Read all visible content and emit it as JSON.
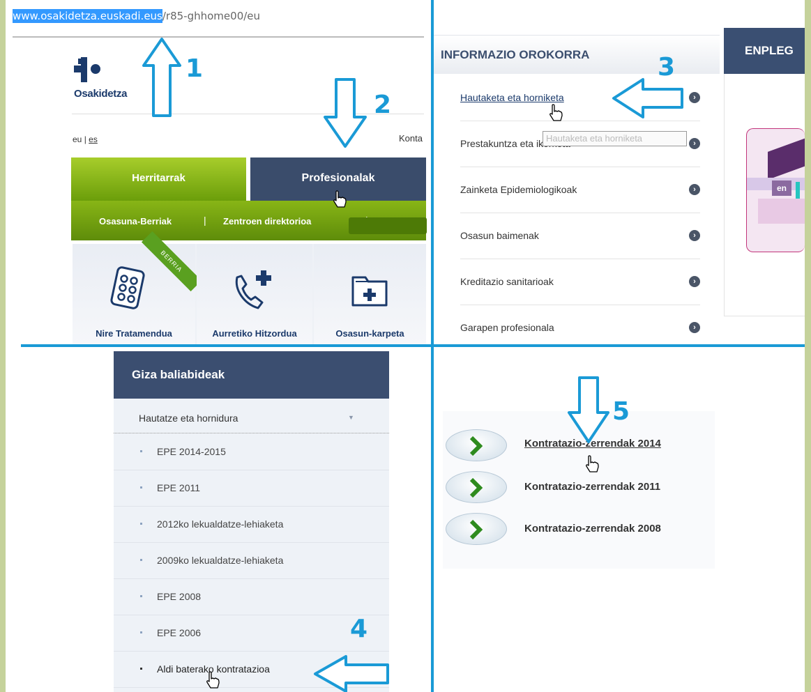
{
  "q1": {
    "url_highlight": "www.osakidetza.euskadi.eus",
    "url_rest": "/r85-ghhome00/eu",
    "logo_text": "Osakidetza",
    "lang_eu": "eu",
    "lang_sep": "|",
    "lang_es": "es",
    "konta_text": "Konta",
    "tab_herritarrak": "Herritarrak",
    "tab_profesionalak": "Profesionalak",
    "subnav": [
      "Osasuna-Berriak",
      "Zentroen direktorioa"
    ],
    "subnav_sep": "|",
    "ribbon": "BERRIA",
    "tiles": [
      "Nire Tratamendua",
      "Aurretiko Hitzordua",
      "Osasun-karpeta"
    ]
  },
  "q2": {
    "header": "INFORMAZIO OROKORRA",
    "enpleg": "ENPLEG",
    "items": [
      "Hautaketa eta horniketa",
      "Prestakuntza eta ikerketa",
      "Zainketa Epidemiologikoak",
      "Osasun baimenak",
      "Kreditazio sanitarioak",
      "Garapen profesionala"
    ],
    "tooltip": "Hautaketa eta horniketa",
    "promo_text": "en"
  },
  "q3": {
    "header": "Giza baliabideak",
    "sub": "Hautatze eta hornidura",
    "items": [
      "EPE 2014-2015",
      "EPE 2011",
      "2012ko lekualdatze-lehiaketa",
      "2009ko lekualdatze-lehiaketa",
      "EPE 2008",
      "EPE 2006",
      "Aldi baterako kontratazioa"
    ]
  },
  "q4": {
    "items": [
      "Kontratazio-zerrendak 2014",
      "Kontratazio-zerrendak 2011",
      "Kontratazio-zerrendak 2008"
    ]
  },
  "annotations": [
    "1",
    "2",
    "3",
    "4",
    "5"
  ],
  "colors": {
    "annotation": "#1a9ad6",
    "navy": "#3a4c6b",
    "green": "#88b516",
    "page_bg": "#c5d29b"
  }
}
